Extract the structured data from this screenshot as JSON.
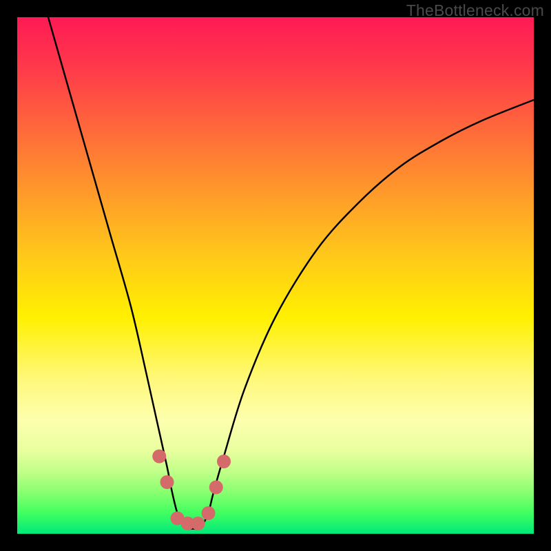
{
  "watermark": "TheBottleneck.com",
  "chart_data": {
    "type": "line",
    "title": "",
    "xlabel": "",
    "ylabel": "",
    "xlim": [
      0,
      100
    ],
    "ylim": [
      0,
      100
    ],
    "series": [
      {
        "name": "bottleneck-curve",
        "x": [
          6,
          10,
          14,
          18,
          22,
          25,
          27,
          29,
          30,
          31,
          32,
          33,
          34,
          35,
          36,
          37,
          38,
          40,
          44,
          50,
          58,
          66,
          74,
          82,
          90,
          100
        ],
        "values": [
          100,
          86,
          72,
          58,
          44,
          31,
          22,
          13,
          8,
          4,
          2,
          1,
          1,
          1,
          2,
          4,
          8,
          15,
          28,
          42,
          55,
          64,
          71,
          76,
          80,
          84
        ]
      }
    ],
    "markers": {
      "name": "highlight-dots",
      "color": "#d46a6a",
      "points": [
        {
          "x": 27.5,
          "y": 15
        },
        {
          "x": 29.0,
          "y": 10
        },
        {
          "x": 31.0,
          "y": 3
        },
        {
          "x": 33.0,
          "y": 2
        },
        {
          "x": 35.0,
          "y": 2
        },
        {
          "x": 37.0,
          "y": 4
        },
        {
          "x": 38.5,
          "y": 9
        },
        {
          "x": 40.0,
          "y": 14
        }
      ]
    },
    "gradient_stops": [
      {
        "pos": 0,
        "color": "#ff1a55"
      },
      {
        "pos": 50,
        "color": "#fff000"
      },
      {
        "pos": 100,
        "color": "#00e87a"
      }
    ]
  }
}
